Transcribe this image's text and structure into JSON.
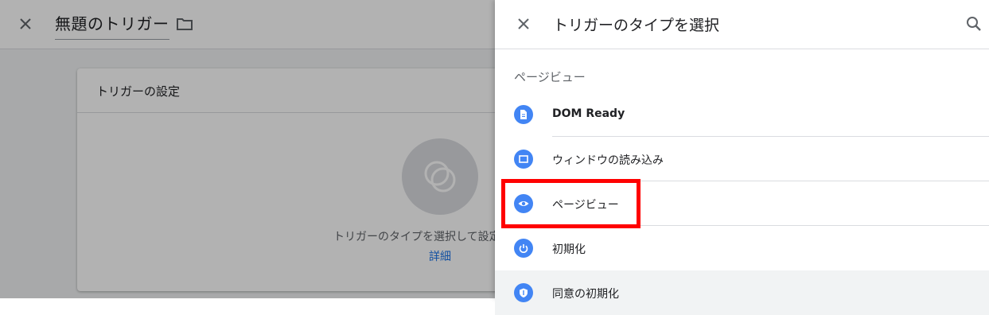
{
  "background": {
    "title": "無題のトリガー",
    "card_title": "トリガーの設定",
    "card_message": "トリガーのタイプを選択して設定",
    "card_link": "詳細"
  },
  "panel": {
    "title": "トリガーのタイプを選択",
    "section_label": "ページビュー",
    "items": [
      {
        "label": "DOM Ready",
        "icon": "document-icon"
      },
      {
        "label": "ウィンドウの読み込み",
        "icon": "window-icon"
      },
      {
        "label": "ページビュー",
        "icon": "eye-icon"
      },
      {
        "label": "初期化",
        "icon": "power-icon"
      },
      {
        "label": "同意の初期化",
        "icon": "shield-icon"
      }
    ]
  },
  "colors": {
    "accent": "#4285f4",
    "highlight_box": "#ff0000",
    "link": "#1a73e8"
  }
}
